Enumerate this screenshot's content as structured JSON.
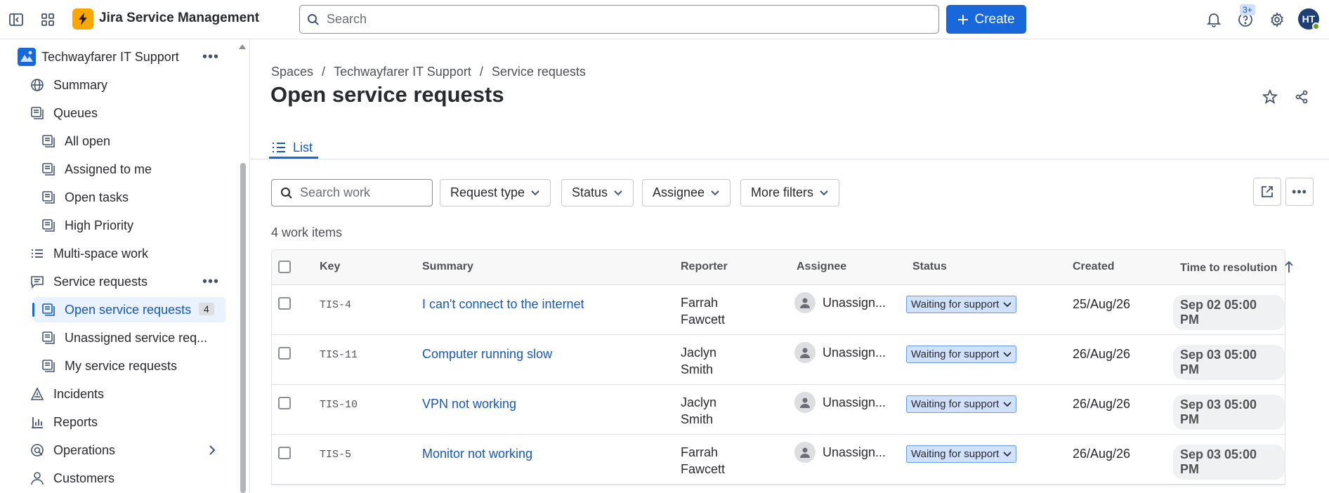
{
  "app": {
    "title": "Jira Service Management",
    "search_placeholder": "Search",
    "create_label": "Create",
    "help_badge": "3+",
    "avatar_initials": "HT"
  },
  "sidebar": {
    "project": "Techwayfarer IT Support",
    "items": [
      {
        "label": "Summary"
      },
      {
        "label": "Queues"
      },
      {
        "label": "All open"
      },
      {
        "label": "Assigned to me"
      },
      {
        "label": "Open tasks"
      },
      {
        "label": "High Priority"
      },
      {
        "label": "Multi-space work"
      },
      {
        "label": "Service requests"
      },
      {
        "label": "Open service requests",
        "count": "4"
      },
      {
        "label": "Unassigned service req..."
      },
      {
        "label": "My service requests"
      },
      {
        "label": "Incidents"
      },
      {
        "label": "Reports"
      },
      {
        "label": "Operations"
      },
      {
        "label": "Customers"
      }
    ]
  },
  "main": {
    "breadcrumb": [
      "Spaces",
      "/",
      "Techwayfarer IT Support",
      "/",
      "Service requests"
    ],
    "title": "Open service requests",
    "tab": "List",
    "search_placeholder": "Search work",
    "filters": [
      "Request type",
      "Status",
      "Assignee",
      "More filters"
    ],
    "count_text": "4 work items"
  },
  "table": {
    "headers": [
      "Key",
      "Summary",
      "Reporter",
      "Assignee",
      "Status",
      "Created",
      "Time to resolution"
    ],
    "rows": [
      {
        "key": "TIS-4",
        "summary": "I can't connect to the internet",
        "reporter_first": "Farrah",
        "reporter_last": "Fawcett",
        "assignee": "Unassign...",
        "status": "Waiting for support",
        "created": "25/Aug/26",
        "ttr": "Sep 02 05:00 PM"
      },
      {
        "key": "TIS-11",
        "summary": "Computer running slow",
        "reporter_first": "Jaclyn",
        "reporter_last": "Smith",
        "assignee": "Unassign...",
        "status": "Waiting for support",
        "created": "26/Aug/26",
        "ttr": "Sep 03 05:00 PM"
      },
      {
        "key": "TIS-10",
        "summary": "VPN not working",
        "reporter_first": "Jaclyn",
        "reporter_last": "Smith",
        "assignee": "Unassign...",
        "status": "Waiting for support",
        "created": "26/Aug/26",
        "ttr": "Sep 03 05:00 PM"
      },
      {
        "key": "TIS-5",
        "summary": "Monitor not working",
        "reporter_first": "Farrah",
        "reporter_last": "Fawcett",
        "assignee": "Unassign...",
        "status": "Waiting for support",
        "created": "26/Aug/26",
        "ttr": "Sep 03 05:00 PM"
      }
    ]
  },
  "colors": {
    "brand_blue": "#1868db",
    "logo_yellow": "#fca700",
    "status_bg": "#cfe1fd",
    "link": "#1558bc"
  }
}
